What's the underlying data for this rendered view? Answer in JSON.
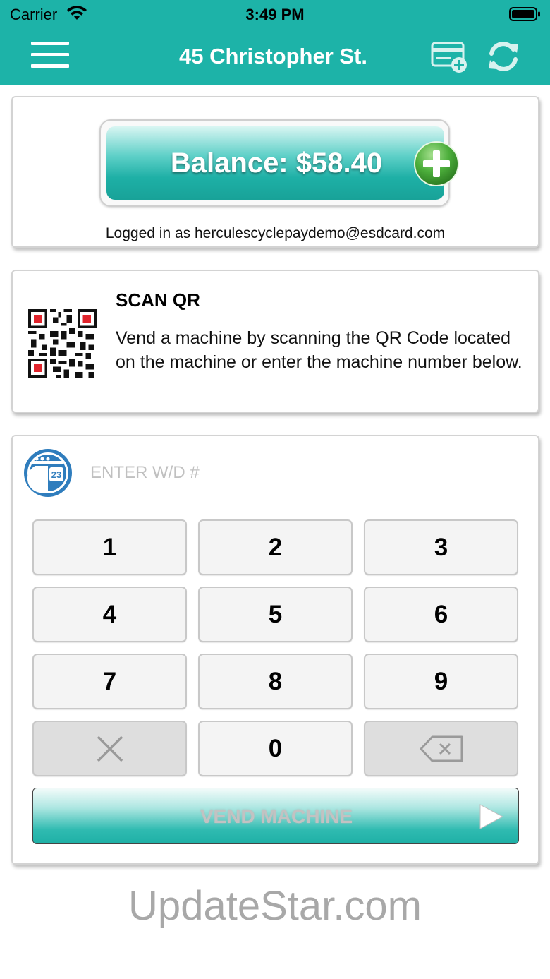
{
  "status_bar": {
    "carrier": "Carrier",
    "time": "3:49 PM"
  },
  "nav": {
    "title": "45 Christopher St.",
    "menu_icon": "hamburger-menu-icon",
    "add_card_icon": "add-card-icon",
    "refresh_icon": "refresh-icon"
  },
  "balance": {
    "label": "Balance: $58.40",
    "add_icon": "plus-circle-icon",
    "logged_in": "Logged in as herculescyclepaydemo@esdcard.com"
  },
  "scan": {
    "title": "SCAN QR",
    "description": "Vend a machine by scanning the QR Code located on the machine or enter the machine number below.",
    "icon": "qr-code-icon"
  },
  "keypad": {
    "placeholder": "ENTER W/D #",
    "icon": "washer-dryer-icon",
    "keys": [
      "1",
      "2",
      "3",
      "4",
      "5",
      "6",
      "7",
      "8",
      "9",
      "0"
    ],
    "clear_icon": "x-icon",
    "backspace_icon": "backspace-icon",
    "vend_label": "VEND MACHINE",
    "vend_icon": "play-arrow-icon"
  },
  "colors": {
    "brand": "#1db3a8",
    "plus_green": "#4cae3b"
  },
  "watermark": "UpdateStar.com"
}
